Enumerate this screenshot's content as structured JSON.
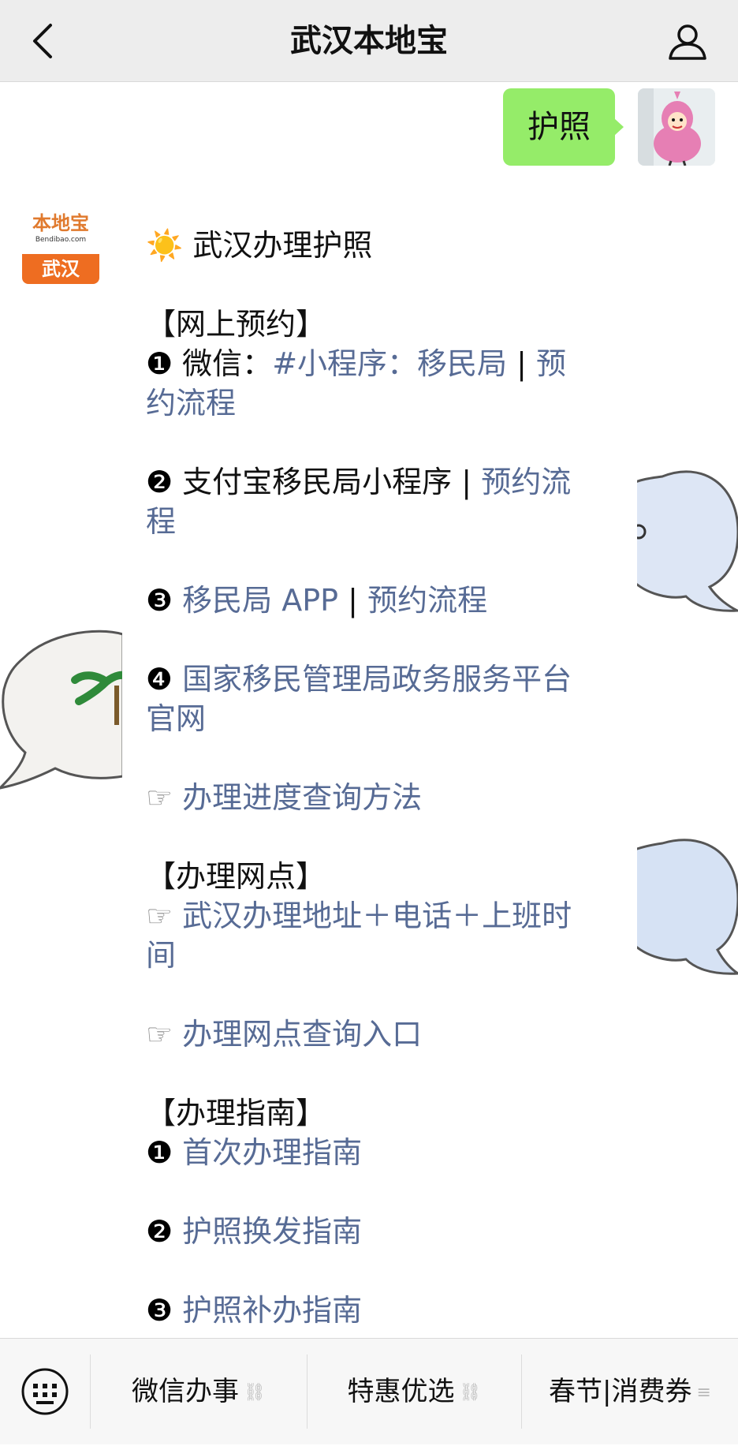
{
  "nav": {
    "title": "武汉本地宝"
  },
  "user_message": {
    "text": "护照"
  },
  "bot": {
    "avatar": {
      "brand": "本地宝",
      "url": "Bendibao.com",
      "city": "武汉"
    },
    "title_icon": "☀️",
    "title": "武汉办理护照",
    "sections": {
      "online": {
        "heading": "【网上预约】",
        "item1_num": "❶",
        "item1_text": "微信：",
        "item1_link1": "#小程序：移民局",
        "item1_sep": "|",
        "item1_link2_line1": "预",
        "item1_link2_line2": "约流程",
        "item2_num": "❷",
        "item2_text": "支付宝移民局小程序",
        "item2_sep": "|",
        "item2_link_line1": "预约流",
        "item2_link_line2": "程",
        "item3_num": "❸",
        "item3_link1": "移民局 APP",
        "item3_sep": "|",
        "item3_link2": "预约流程",
        "item4_num": "❹",
        "item4_link_line1": "国家移民管理局政务服务平台",
        "item4_link_line2": "官网",
        "progress_hand": "☞",
        "progress_link": "办理进度查询方法"
      },
      "outlets": {
        "heading": "【办理网点】",
        "hand": "☞",
        "addr_link_line1": "武汉办理地址＋电话＋上班时",
        "addr_link_line2": "间",
        "query_hand": "☞",
        "query_link": "办理网点查询入口"
      },
      "guide": {
        "heading": "【办理指南】",
        "g1_num": "❶",
        "g1_link": "首次办理指南",
        "g2_num": "❷",
        "g2_link": "护照换发指南",
        "g3_num": "❸",
        "g3_link": "护照补办指南"
      }
    }
  },
  "toolbar": {
    "menu1": "微信办事",
    "menu2": "特惠优选",
    "menu3": "春节|消费券",
    "menu1_icon": "link-icon",
    "menu2_icon": "link-icon",
    "menu3_icon": "menu-lines-icon"
  },
  "colors": {
    "link": "#576b95",
    "bubble": "#95ec69",
    "nav": "#ededed",
    "brand": "#ee6d21"
  }
}
